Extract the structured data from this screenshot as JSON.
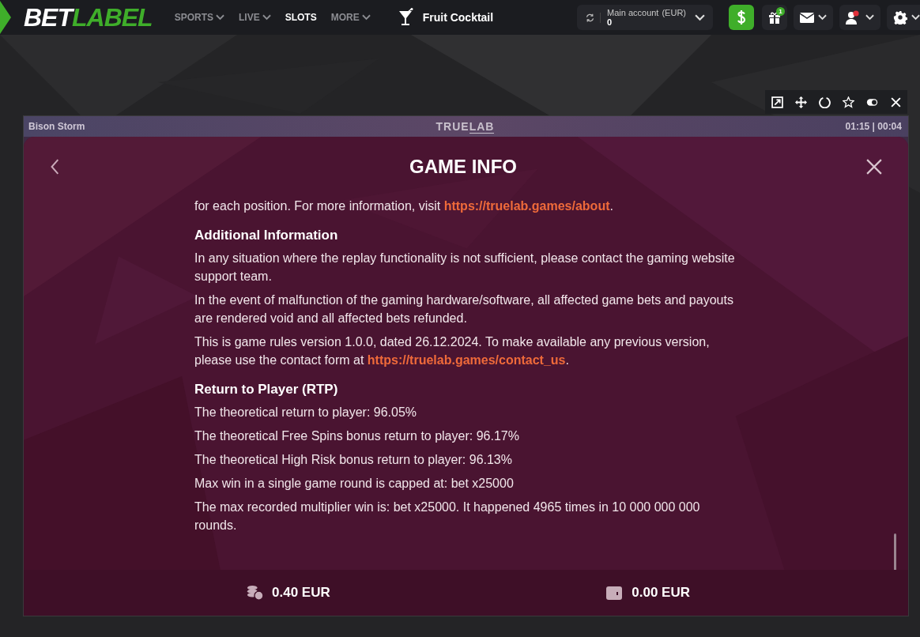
{
  "logo": {
    "part_1": "BET",
    "part_2": "LABEL"
  },
  "nav": [
    {
      "label": "SPORTS",
      "selected": false,
      "dropdown": true
    },
    {
      "label": "LIVE",
      "selected": false,
      "dropdown": true
    },
    {
      "label": "SLOTS",
      "selected": true,
      "dropdown": false
    },
    {
      "label": "MORE",
      "selected": false,
      "dropdown": true
    }
  ],
  "current_game": "Fruit Cocktail",
  "account": {
    "label": "Main account",
    "currency": "(EUR)",
    "balance": "0"
  },
  "gift_badge": "1",
  "game_bar": {
    "title": "Bison Storm",
    "provider_part_1": "TRUE",
    "provider_part_2": "LAB",
    "timer": "01:15 | 00:04"
  },
  "modal": {
    "title": "GAME INFO",
    "blocks": [
      {
        "kind": "paragraph",
        "parts": [
          {
            "text": "for each position. For more information, visit "
          },
          {
            "link": "https://truelab.games/about"
          },
          {
            "text": "."
          }
        ]
      },
      {
        "kind": "heading",
        "text": "Additional Information"
      },
      {
        "kind": "paragraph",
        "parts": [
          {
            "text": "In any situation where the replay functionality is not sufficient, please contact the gaming website support team."
          }
        ]
      },
      {
        "kind": "paragraph",
        "parts": [
          {
            "text": "In the event of malfunction of the gaming hardware/software, all affected game bets and payouts are rendered void and all affected bets refunded."
          }
        ]
      },
      {
        "kind": "paragraph",
        "parts": [
          {
            "text": "This is game rules version 1.0.0, dated 26.12.2024. To make available any previous version, please use the contact form at "
          },
          {
            "link": "https://truelab.games/contact_us"
          },
          {
            "text": "."
          }
        ]
      },
      {
        "kind": "heading",
        "text": "Return to Player (RTP)"
      },
      {
        "kind": "paragraph",
        "parts": [
          {
            "text": "The theoretical return to player: 96.05%"
          }
        ]
      },
      {
        "kind": "paragraph",
        "parts": [
          {
            "text": "The theoretical Free Spins bonus return to player: 96.17%"
          }
        ]
      },
      {
        "kind": "paragraph",
        "parts": [
          {
            "text": "The theoretical High Risk bonus return to player: 96.13%"
          }
        ]
      },
      {
        "kind": "paragraph",
        "parts": [
          {
            "text": "Max win in a single game round is capped at: bet x25000"
          }
        ]
      },
      {
        "kind": "paragraph",
        "parts": [
          {
            "text": "The max recorded multiplier win is: bet x25000. It happened 4965 times in 10 000 000 000 rounds."
          }
        ]
      }
    ]
  },
  "footer": {
    "bet": "0.40 EUR",
    "balance": "0.00 EUR"
  }
}
